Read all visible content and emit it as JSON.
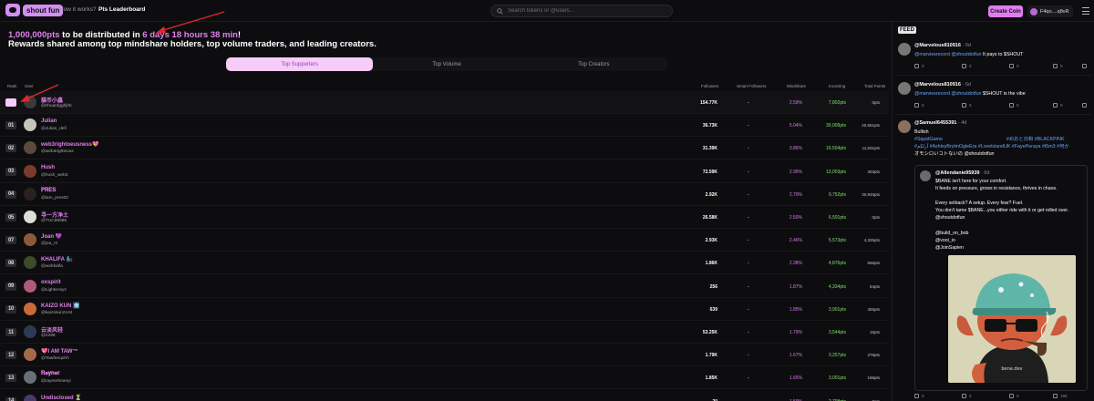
{
  "nav": {
    "logo_text": "shout fun",
    "links": [
      "How it works?",
      "Pts Leaderboard"
    ],
    "search_placeholder": "Search tokens or @users...",
    "create_button": "Create Coin",
    "user_label": "F4qo....q8vR"
  },
  "banner": {
    "points": "1,000,000pts",
    "mid": " to be distributed in ",
    "countdown": "6 days 18 hours 38 min",
    "bang": "!",
    "subtitle": "Rewards shared among top mindshare holders, top volume traders, and leading creators."
  },
  "tabs": [
    "Top Supporters",
    "Top Volume",
    "Top Creators"
  ],
  "table": {
    "headers": {
      "rank": "Rank",
      "user": "User",
      "followers": "Followers",
      "smart": "Smart Followers",
      "mindshare": "Mindshare",
      "incoming": "Incoming",
      "total": "Total Points"
    },
    "rows": [
      {
        "rank": "01",
        "name": "貓币小鑫",
        "handle": "@zhuanfgghjhb",
        "followers": "154.77K",
        "smart": "-",
        "mindshare": "2.59%",
        "incoming": "7,802pts",
        "total": "0pts",
        "color": "#3a3a3a"
      },
      {
        "rank": "01",
        "name": "Julian",
        "handle": "@Julian_defi",
        "followers": "36.73K",
        "smart": "-",
        "mindshare": "5.04%",
        "incoming": "39,009pts",
        "total": "20,661pts",
        "color": "#c9c4ba"
      },
      {
        "rank": "02",
        "name": "web3rightoeusness💖",
        "handle": "@web3rightsous",
        "followers": "31.39K",
        "smart": "-",
        "mindshare": "3.86%",
        "incoming": "19,504pts",
        "total": "11,531pts",
        "color": "#5a4a3e"
      },
      {
        "rank": "03",
        "name": "Hush",
        "handle": "@hush_web3",
        "followers": "72.59K",
        "smart": "-",
        "mindshare": "2.95%",
        "incoming": "13,003pts",
        "total": "303pts",
        "color": "#7a3b2e"
      },
      {
        "rank": "04",
        "name": "𝐏𝐑𝐄𝐒",
        "handle": "@iam_pres02",
        "followers": "2.92K",
        "smart": "-",
        "mindshare": "2.70%",
        "incoming": "9,752pts",
        "total": "30,933pts",
        "color": "#2a2222"
      },
      {
        "rank": "05",
        "name": "寻一方净土",
        "handle": "@TUC88888",
        "followers": "26.58K",
        "smart": "-",
        "mindshare": "2.50%",
        "incoming": "6,501pts",
        "total": "0pts",
        "color": "#e0ddd8"
      },
      {
        "rank": "07",
        "name": "Joan 💜",
        "handle": "@joa_nl",
        "followers": "2.93K",
        "smart": "-",
        "mindshare": "2.46%",
        "incoming": "5,573pts",
        "total": "4,326pts",
        "color": "#8a5a3a"
      },
      {
        "rank": "08",
        "name": "KHALIFA 🧞",
        "handle": "@webfalifa",
        "followers": "1.86K",
        "smart": "-",
        "mindshare": "2.38%",
        "incoming": "4,876pts",
        "total": "666pts",
        "color": "#3e4a2a"
      },
      {
        "rank": "09",
        "name": "oxspirit",
        "handle": "@Lightenxyz",
        "followers": "256",
        "smart": "-",
        "mindshare": "1.87%",
        "incoming": "4,334pts",
        "total": "54pts",
        "color": "#b05a7a"
      },
      {
        "rank": "10",
        "name": "KAIZO KUN 🩻",
        "handle": "@kaizokun2144",
        "followers": "639",
        "smart": "-",
        "mindshare": "1.85%",
        "incoming": "3,901pts",
        "total": "455pts",
        "color": "#c96a3a"
      },
      {
        "rank": "11",
        "name": "云淡风轻",
        "handle": "@2288",
        "followers": "53.25K",
        "smart": "-",
        "mindshare": "1.79%",
        "incoming": "3,544pts",
        "total": "15pts",
        "color": "#2c3a55"
      },
      {
        "rank": "12",
        "name": "💖I AM TAW™",
        "handle": "@Tawfeeqohh",
        "followers": "1.79K",
        "smart": "-",
        "mindshare": "1.67%",
        "incoming": "3,257pts",
        "total": "278pts",
        "color": "#a56a4a"
      },
      {
        "rank": "13",
        "name": "𝐑𝐚𝐲𝐧𝐞𝐫",
        "handle": "@raynerheanyi",
        "followers": "1.85K",
        "smart": "-",
        "mindshare": "1.65%",
        "incoming": "3,001pts",
        "total": "196pts",
        "color": "#6a6e78"
      },
      {
        "rank": "14",
        "name": "Undisclosed ⏳",
        "handle": "@drag_race5932",
        "followers": "20",
        "smart": "-",
        "mindshare": "1.59%",
        "incoming": "2,798pts",
        "total": "0pts",
        "color": "#4a3a6a"
      }
    ]
  },
  "feed": {
    "title": "FEED",
    "posts": [
      {
        "author": "@Marvelous810916",
        "age": "· 6d",
        "mention": "@marviesrecord @shoutdotfun",
        "text": "It pays to $SHOUT",
        "stats": [
          "0",
          "0",
          "0",
          "0"
        ]
      },
      {
        "author": "@Marvelous810916",
        "age": "· 6d",
        "mention": "@marviesrecord @shoutdotfun",
        "text": "$SHOUT is the vibe",
        "stats": [
          "0",
          "0",
          "0",
          "0"
        ]
      },
      {
        "author": "@Samuel6455391",
        "age": "· 4d",
        "line1": "Bullish",
        "line2": "#SquidGame",
        "line2b": "#めおと日和 #BLACKPINK",
        "line3": "#آرلكم #AshleyBrylmOgleEra #LovelslandUK #FayePeraya #t5m3 #何か",
        "line4": "オモシロいコトないの @shoutdotfun"
      },
      {
        "author": "@Allendanie95939",
        "age": "· 6d",
        "q1": "$BANE isn't here for your comfort.",
        "q2": "It feeds on pressure, grows in resistance, thrives in chaos.",
        "q3": "Every setback? A setup. Every fear? Fuel.",
        "q4": "You don't tame $BANE...you either ride with it or get rolled over.",
        "q5": "@shoutdotfun",
        "q6": "@build_on_bob",
        "q7": "@vooi_io",
        "q8": "@JoinSapien",
        "shirt_text": "bene.dev"
      }
    ],
    "bottom_stats": [
      "0",
      "0",
      "0",
      "16K"
    ]
  }
}
